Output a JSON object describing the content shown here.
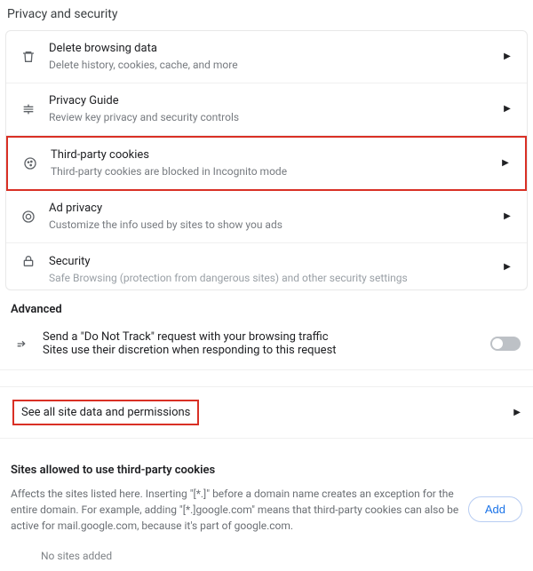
{
  "header": {
    "title": "Privacy and security"
  },
  "card": {
    "items": [
      {
        "title": "Delete browsing data",
        "sub": "Delete history, cookies, cache, and more"
      },
      {
        "title": "Privacy Guide",
        "sub": "Review key privacy and security controls"
      },
      {
        "title": "Third-party cookies",
        "sub": "Third-party cookies are blocked in Incognito mode"
      },
      {
        "title": "Ad privacy",
        "sub": "Customize the info used by sites to show you ads"
      },
      {
        "title": "Security",
        "sub": "Safe Browsing (protection from dangerous sites) and other security settings"
      }
    ]
  },
  "advanced": {
    "label": "Advanced",
    "dnt": {
      "title": "Send a \"Do Not Track\" request with your browsing traffic",
      "sub": "Sites use their discretion when responding to this request"
    }
  },
  "permissions_link": "See all site data and permissions",
  "third_party": {
    "heading": "Sites allowed to use third-party cookies",
    "desc": "Affects the sites listed here. Inserting \"[*.]\" before a domain name creates an exception for the entire domain. For example, adding \"[*.]google.com\" means that third-party cookies can also be active for mail.google.com, because it's part of google.com.",
    "add_label": "Add",
    "empty": "No sites added"
  }
}
